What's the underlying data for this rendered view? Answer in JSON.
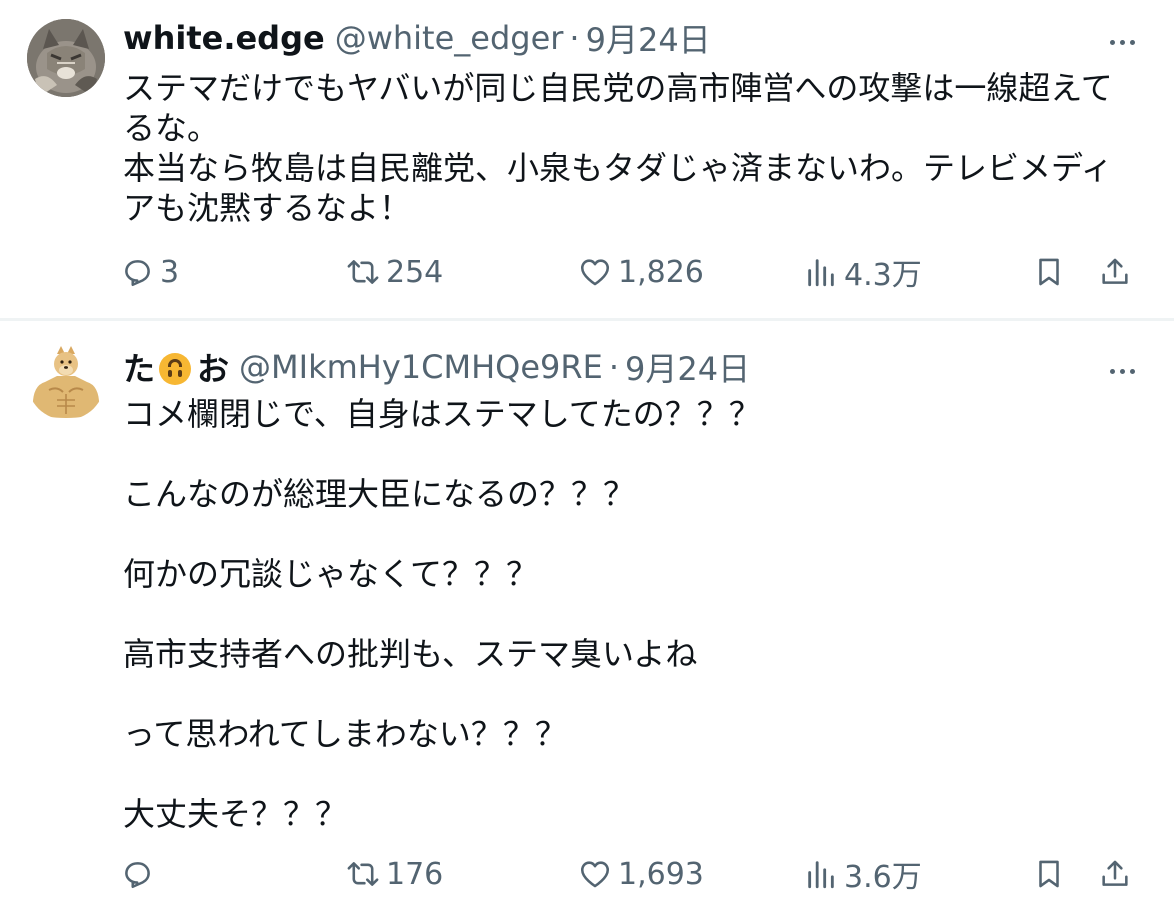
{
  "posts": [
    {
      "display_name": "white.edge",
      "handle": "@white_edger",
      "separator": "·",
      "date": "9月24日",
      "text_lines": [
        "ステマだけでもヤバいが同じ自民党の高市陣営への攻撃は一線超えて",
        "るな。",
        "本当なら牧島は自民離党、小泉もタダじゃ済まないわ。テレビメディ",
        "アも沈黙するなよ！"
      ],
      "stats": {
        "replies": "3",
        "reposts": "254",
        "likes": "1,826",
        "views": "4.3万"
      },
      "avatar_icon": "cat-photo-avatar"
    },
    {
      "display_name_prefix": "た",
      "display_name_emoji": "upside-down-face-emoji",
      "display_name_suffix": "お",
      "handle": "@MIkmHy1CMHQe9RE",
      "separator": "·",
      "date": "9月24日",
      "paragraphs": [
        "コメ欄閉じで、自身はステマしてたの？？？",
        "こんなのが総理大臣になるの？？？",
        "何かの冗談じゃなくて？？？",
        "高市支持者への批判も、ステマ臭いよね",
        "って思われてしまわない？？？",
        "大丈夫そ？？？"
      ],
      "stats": {
        "replies": "",
        "reposts": "176",
        "likes": "1,693",
        "views": "3.6万"
      },
      "avatar_icon": "muscular-doge-avatar"
    }
  ],
  "colors": {
    "text": "#0f1419",
    "secondary": "#536471",
    "divider": "#eff3f4",
    "emoji": "#f7b733"
  },
  "icons": [
    "more-icon",
    "reply-icon",
    "repost-icon",
    "like-icon",
    "views-icon",
    "bookmark-icon",
    "share-icon"
  ]
}
